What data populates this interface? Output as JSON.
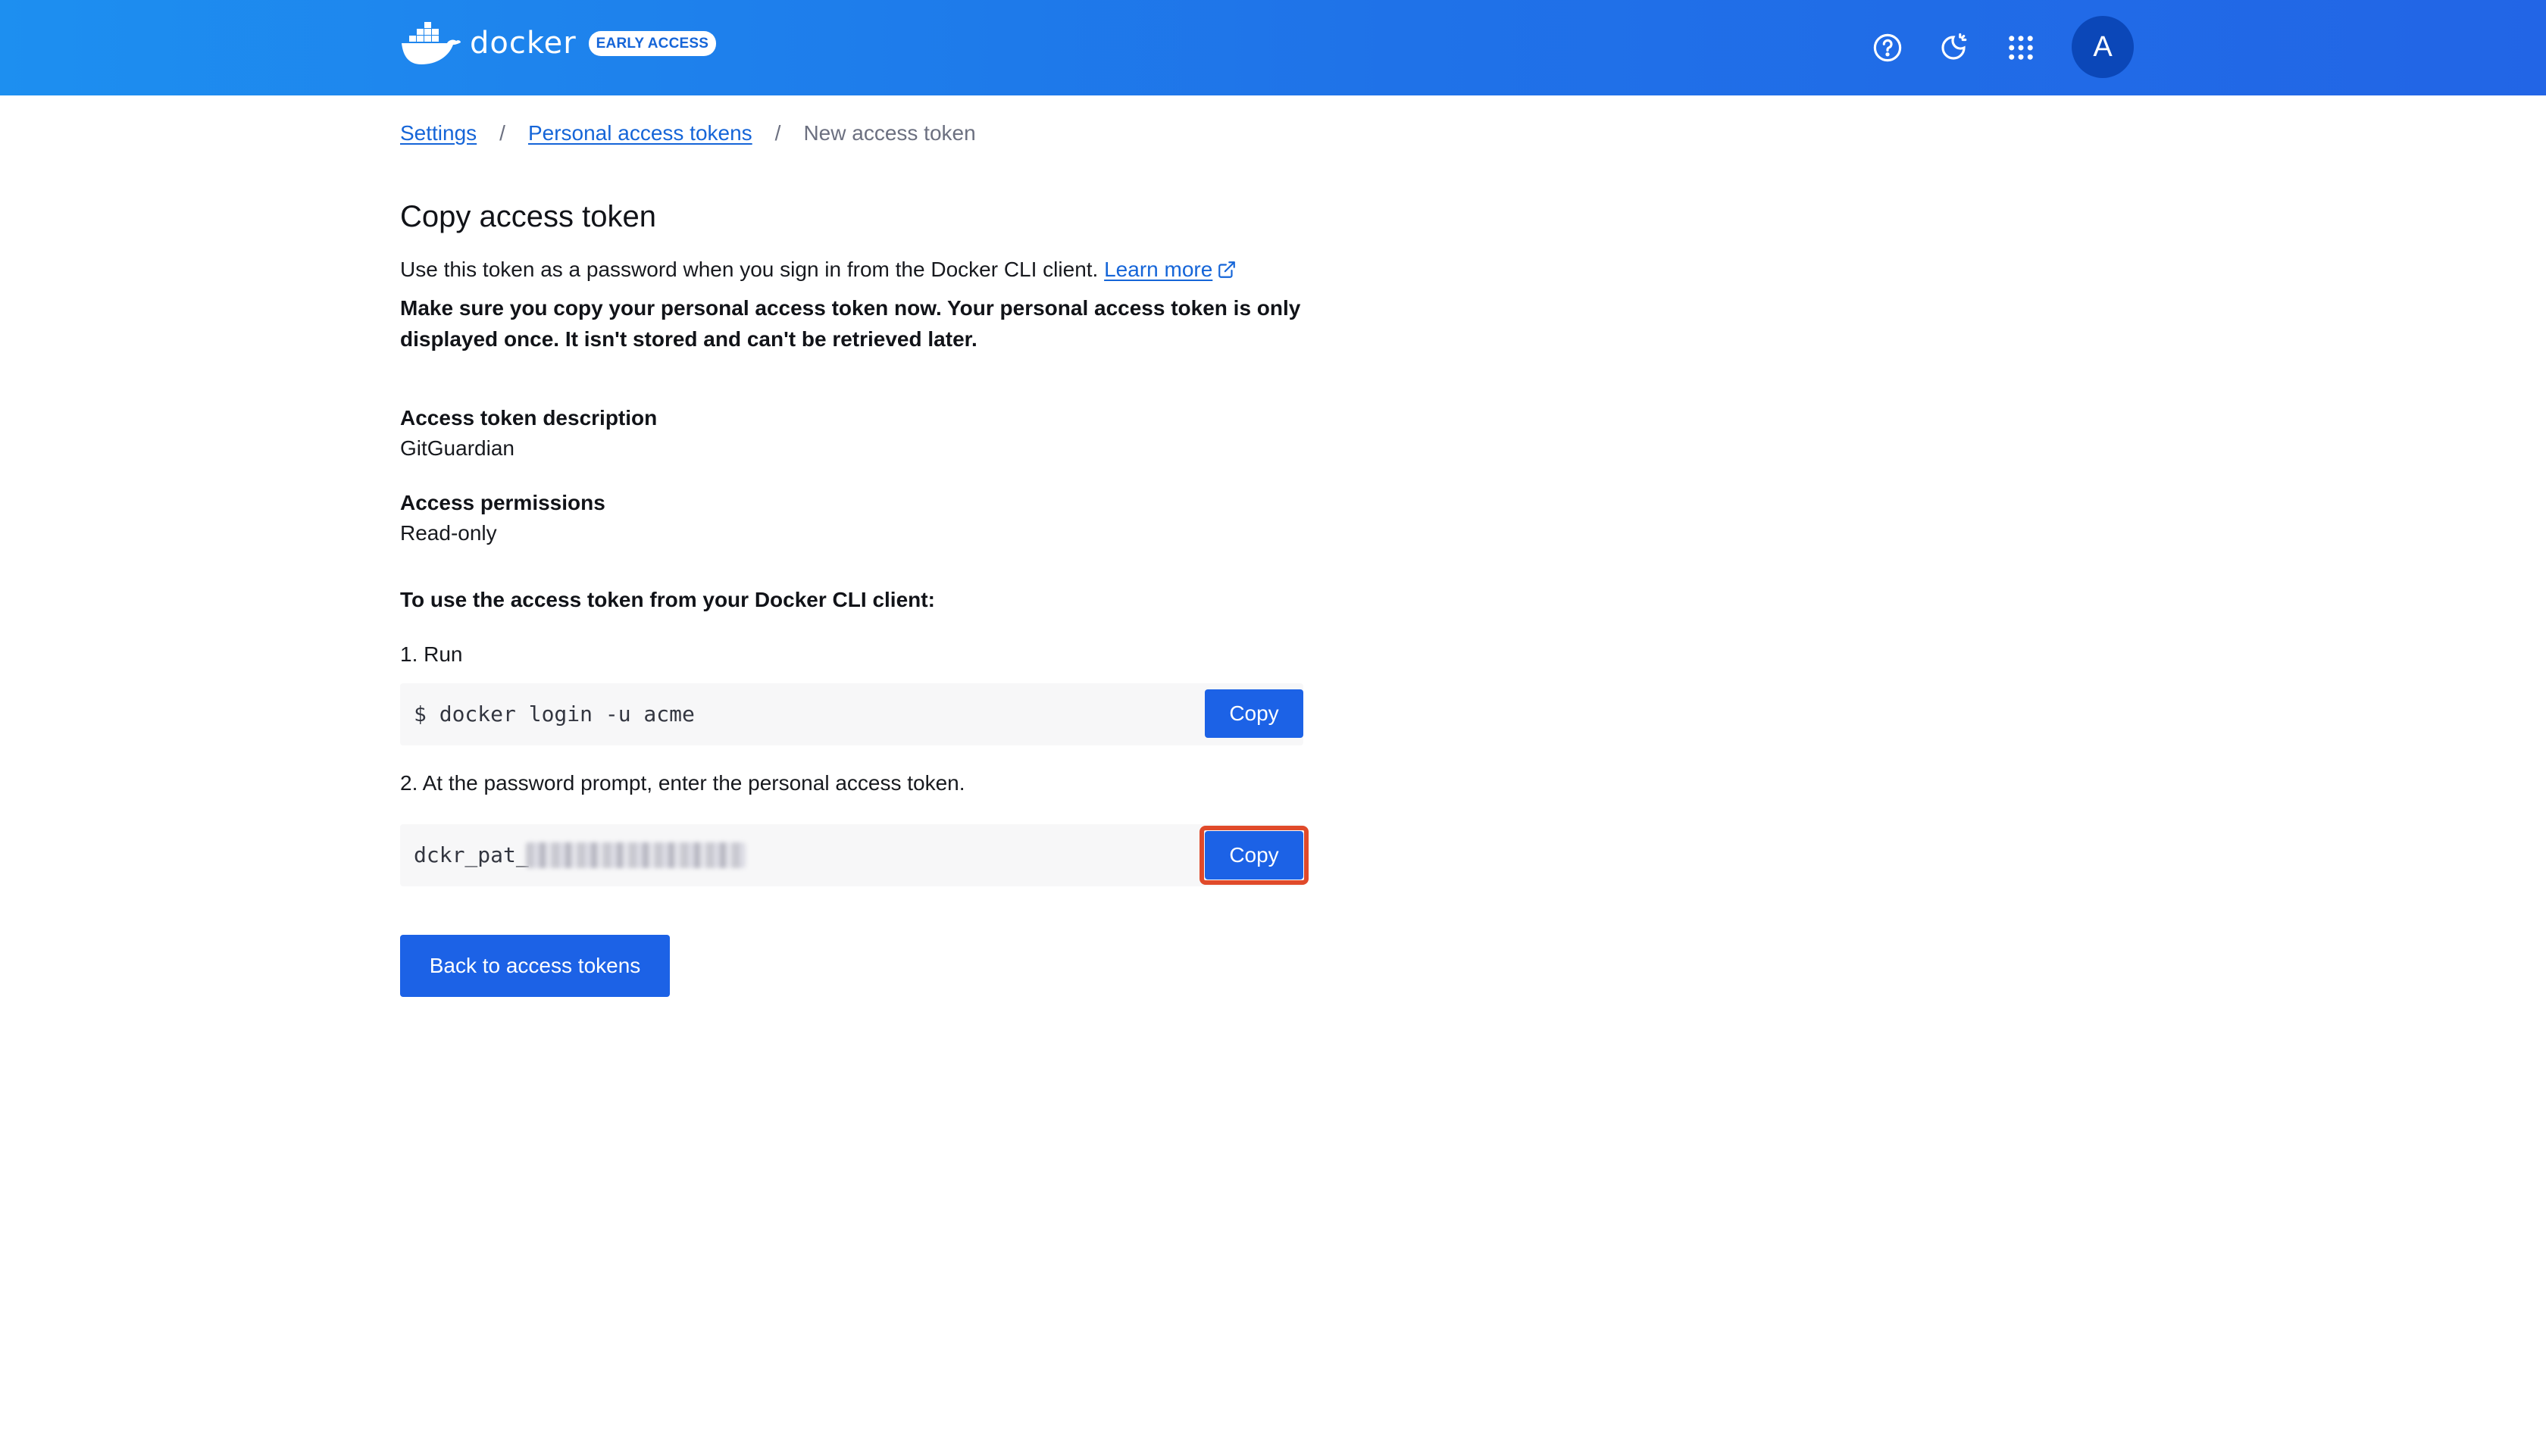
{
  "header": {
    "brand": "docker",
    "badge": "EARLY ACCESS",
    "avatar_initial": "A",
    "icons": [
      "help-icon",
      "theme-toggle-icon",
      "apps-grid-icon"
    ]
  },
  "breadcrumb": {
    "items": [
      "Settings",
      "Personal access tokens"
    ],
    "current": "New access token",
    "separator": "/"
  },
  "page": {
    "title": "Copy access token",
    "intro": "Use this token as a password when you sign in from the Docker CLI client.",
    "learn_more": "Learn more",
    "warning": "Make sure you copy your personal access token now. Your personal access token is only displayed once. It isn't stored and can't be retrieved later."
  },
  "token_info": {
    "description_label": "Access token description",
    "description_value": "GitGuardian",
    "permissions_label": "Access permissions",
    "permissions_value": "Read-only"
  },
  "instructions": {
    "heading": "To use the access token from your Docker CLI client:",
    "step1": "1. Run",
    "command": "$ docker login -u acme",
    "step2": "2. At the password prompt, enter the personal access token.",
    "token_prefix": "dckr_pat_",
    "copy_label": "Copy"
  },
  "actions": {
    "back_label": "Back to access tokens"
  },
  "colors": {
    "primary": "#1c62e6",
    "header_start": "#1d8ff0",
    "header_end": "#2265e6",
    "highlight": "#e04a2a",
    "avatar_bg": "#0b47b8"
  }
}
